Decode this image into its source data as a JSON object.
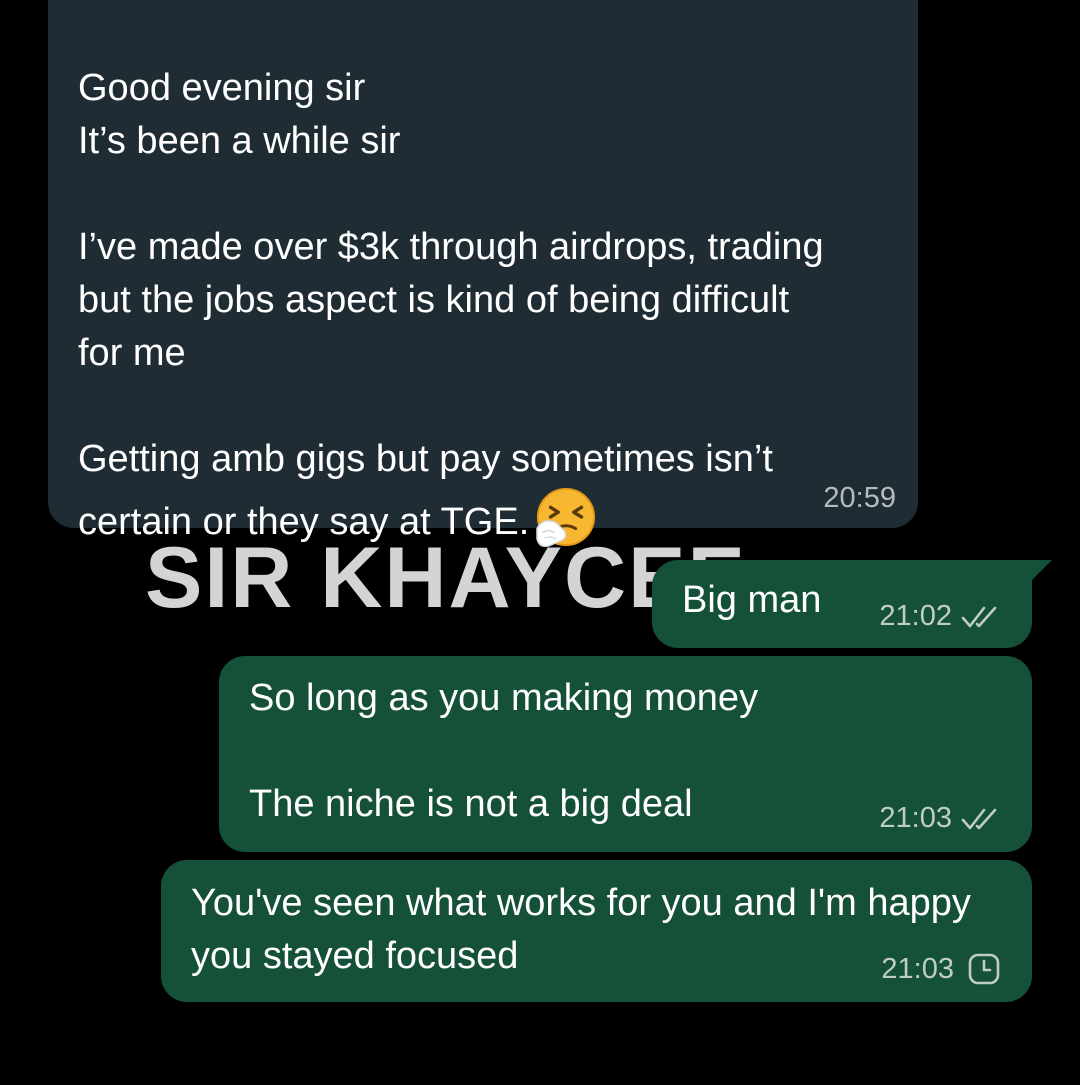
{
  "watermark": {
    "text": "SIR KHAYCEE"
  },
  "messages": [
    {
      "direction": "incoming",
      "text": "Good evening sir\nIt’s been a while sir\n\nI’ve made over $3k through airdrops, trading but the jobs aspect is kind of being difficult for me\n\nGetting amb gigs but pay sometimes isn’t certain or they say at TGE.",
      "emoji": "sneezing-face",
      "time": "20:59"
    },
    {
      "direction": "outgoing",
      "text": "Big man",
      "time": "21:02",
      "status": "read-double-tick"
    },
    {
      "direction": "outgoing",
      "text": "So long as you making money\n\nThe niche is not a big deal",
      "time": "21:03",
      "status": "read-double-tick"
    },
    {
      "direction": "outgoing",
      "text": "You've seen what works for you and I'm happy you stayed focused",
      "time": "21:03",
      "status": "pending-clock"
    }
  ],
  "colors": {
    "background": "#000000",
    "incoming_bubble": "#202c33",
    "outgoing_bubble": "#155038",
    "text": "#ffffff",
    "meta": "#c0ccc6"
  }
}
